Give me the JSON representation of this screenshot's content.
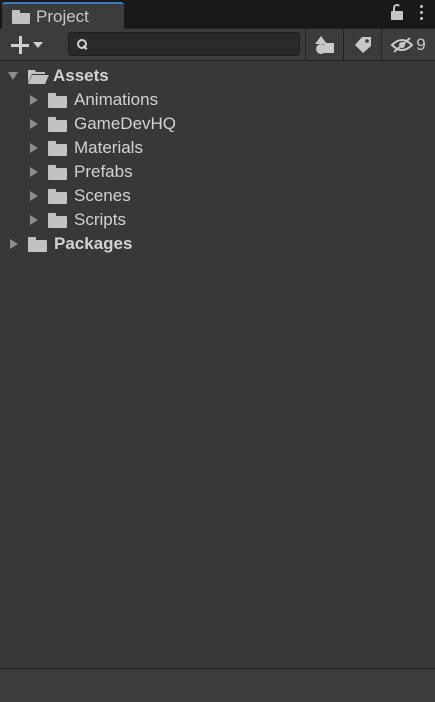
{
  "window": {
    "tab_title": "Project",
    "tab_icon": "folder-icon",
    "lock_icon": "lock-icon",
    "menu_icon": "kebab-menu-icon"
  },
  "toolbar": {
    "create_icon": "plus-icon",
    "create_dropdown_icon": "caret-down-icon",
    "search": {
      "value": "",
      "icon": "search-icon"
    },
    "search_by_type_icon": "shapes-icon",
    "search_by_label_icon": "tag-icon",
    "hidden_packages_icon": "eye-slash-icon",
    "hidden_packages_count": "9"
  },
  "tree": {
    "root": {
      "label": "Assets",
      "expanded": true,
      "children": [
        {
          "label": "Animations"
        },
        {
          "label": "GameDevHQ"
        },
        {
          "label": "Materials"
        },
        {
          "label": "Prefabs"
        },
        {
          "label": "Scenes"
        },
        {
          "label": "Scripts"
        }
      ]
    },
    "packages": {
      "label": "Packages",
      "expanded": false
    }
  },
  "colors": {
    "background": "#383838",
    "tab_accent": "#3a79bb",
    "text": "#d2d2d2"
  }
}
